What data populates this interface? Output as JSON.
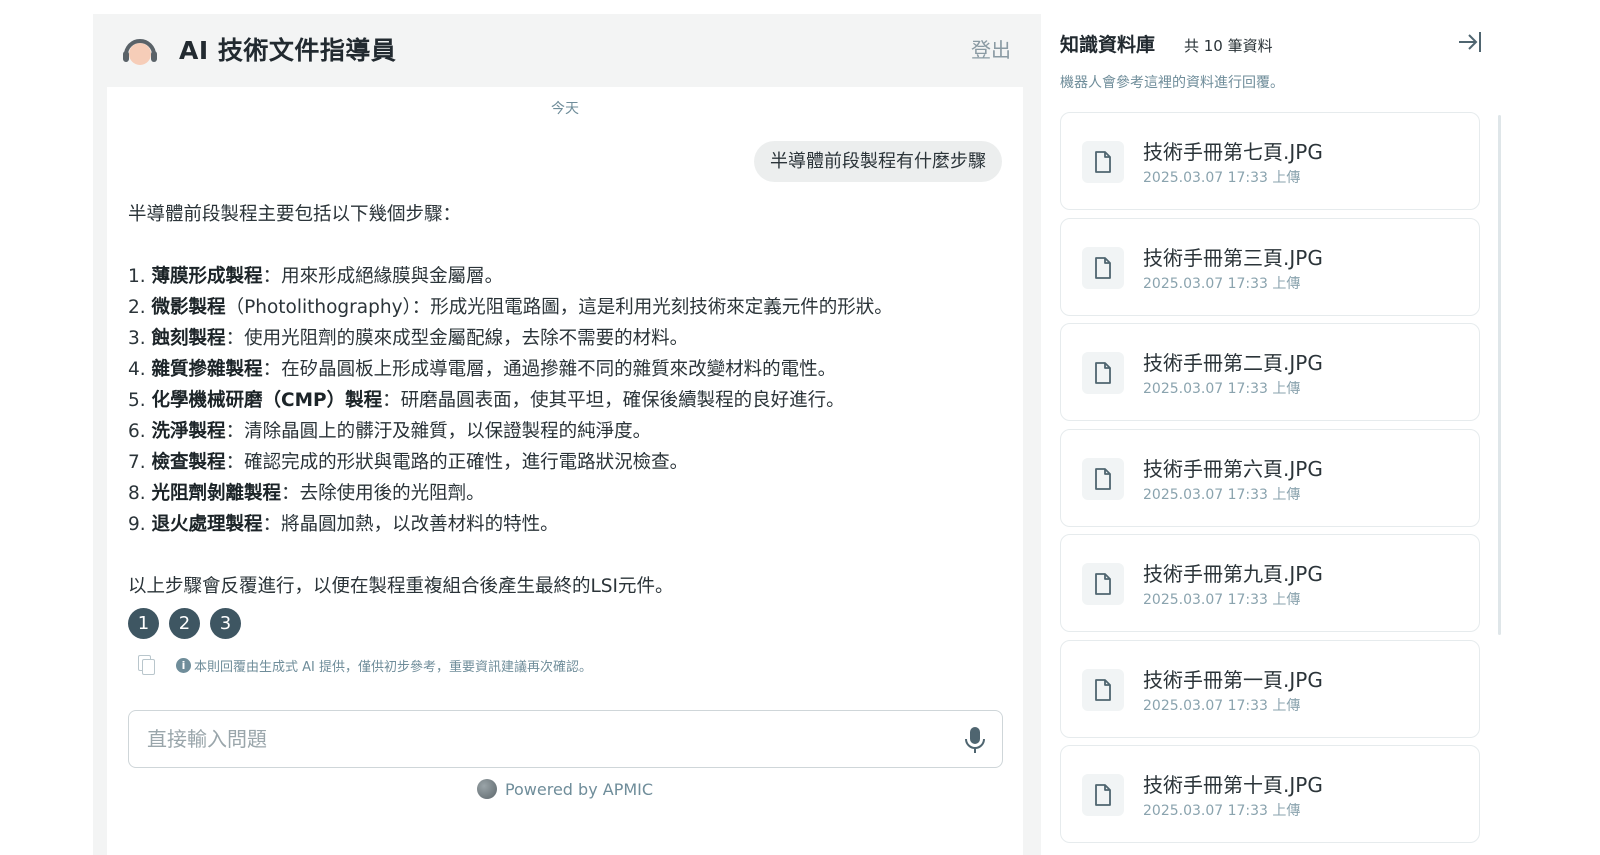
{
  "header": {
    "title": "AI 技術文件指導員",
    "logout_label": "登出"
  },
  "chat": {
    "day_label": "今天",
    "user_message": "半導體前段製程有什麼步驟",
    "answer": {
      "intro": "半導體前段製程主要包括以下幾個步驟：",
      "steps": [
        {
          "num": "1.",
          "term": "薄膜形成製程",
          "desc": "：用來形成絕緣膜與金屬層。"
        },
        {
          "num": "2.",
          "term": "微影製程",
          "desc": "（Photolithography）：形成光阻電路圖，這是利用光刻技術來定義元件的形狀。"
        },
        {
          "num": "3.",
          "term": "蝕刻製程",
          "desc": "：使用光阻劑的膜來成型金屬配線，去除不需要的材料。"
        },
        {
          "num": "4.",
          "term": "雜質摻雜製程",
          "desc": "：在矽晶圓板上形成導電層，通過摻雜不同的雜質來改變材料的電性。"
        },
        {
          "num": "5.",
          "term": "化學機械研磨（CMP）製程",
          "desc": "：研磨晶圓表面，使其平坦，確保後續製程的良好進行。"
        },
        {
          "num": "6.",
          "term": "洗淨製程",
          "desc": "：清除晶圓上的髒汙及雜質，以保證製程的純淨度。"
        },
        {
          "num": "7.",
          "term": "檢查製程",
          "desc": "：確認完成的形狀與電路的正確性，進行電路狀況檢查。"
        },
        {
          "num": "8.",
          "term": "光阻劑剝離製程",
          "desc": "：去除使用後的光阻劑。"
        },
        {
          "num": "9.",
          "term": "退火處理製程",
          "desc": "：將晶圓加熱，以改善材料的特性。"
        }
      ],
      "outro": "以上步驟會反覆進行，以便在製程重複組合後產生最終的LSI元件。"
    },
    "references": [
      "1",
      "2",
      "3"
    ],
    "disclaimer": "本則回覆由生成式 AI 提供，僅供初步參考，重要資訊建議再次確認。",
    "input_placeholder": "直接輸入問題",
    "powered_by": "Powered by APMIC"
  },
  "knowledge_base": {
    "title": "知識資料庫",
    "count": "共 10 筆資料",
    "subtitle": "機器人會參考這裡的資料進行回覆。",
    "files": [
      {
        "name": "技術手冊第七頁.JPG",
        "date": "2025.03.07 17:33 上傳"
      },
      {
        "name": "技術手冊第三頁.JPG",
        "date": "2025.03.07 17:33 上傳"
      },
      {
        "name": "技術手冊第二頁.JPG",
        "date": "2025.03.07 17:33 上傳"
      },
      {
        "name": "技術手冊第六頁.JPG",
        "date": "2025.03.07 17:33 上傳"
      },
      {
        "name": "技術手冊第九頁.JPG",
        "date": "2025.03.07 17:33 上傳"
      },
      {
        "name": "技術手冊第一頁.JPG",
        "date": "2025.03.07 17:33 上傳"
      },
      {
        "name": "技術手冊第十頁.JPG",
        "date": "2025.03.07 17:33 上傳"
      }
    ]
  },
  "colors": {
    "accent": "#3e5662",
    "muted_text": "#6f8d9a",
    "panel_bg": "#f3f4f4"
  }
}
